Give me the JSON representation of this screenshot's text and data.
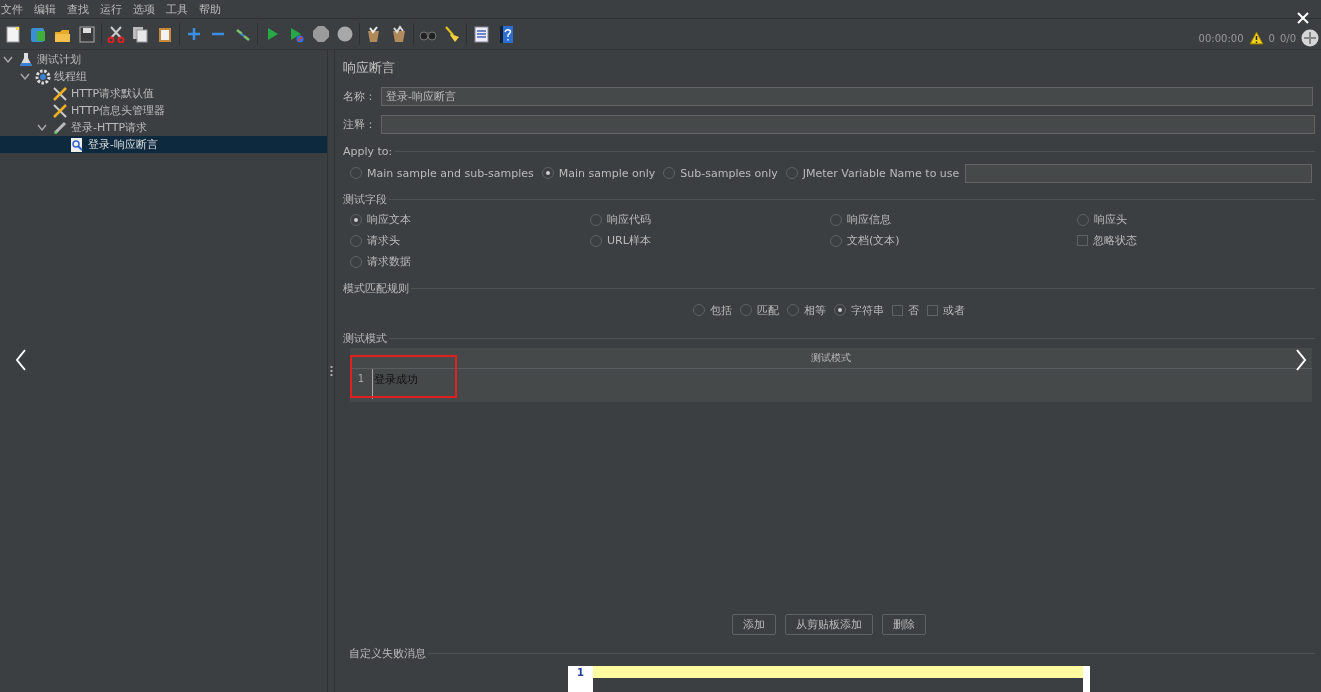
{
  "menu": [
    "文件",
    "编辑",
    "查找",
    "运行",
    "选项",
    "工具",
    "帮助"
  ],
  "status": {
    "elapsed": "00:00:00",
    "warnings": "0",
    "threads": "0/0"
  },
  "tree": [
    {
      "label": "测试计划",
      "kind": "plan",
      "expanded": true,
      "selected": false,
      "children": [
        {
          "label": "线程组",
          "kind": "group",
          "expanded": true,
          "selected": false,
          "children": [
            {
              "label": "HTTP请求默认值",
              "kind": "config",
              "selected": false
            },
            {
              "label": "HTTP信息头管理器",
              "kind": "config",
              "selected": false
            },
            {
              "label": "登录-HTTP请求",
              "kind": "sampler",
              "expanded": true,
              "selected": false,
              "children": [
                {
                  "label": "登录-响应断言",
                  "kind": "assertion",
                  "selected": true
                }
              ]
            }
          ]
        }
      ]
    }
  ],
  "panel": {
    "title": "响应断言",
    "name_label": "名称：",
    "name": "登录-响应断言",
    "comment_label": "注释："
  },
  "apply_to": {
    "legend": "Apply to:",
    "options": [
      {
        "kind": "radio",
        "label": "Main sample and sub-samples",
        "selected": false
      },
      {
        "kind": "radio",
        "label": "Main sample only",
        "selected": true
      },
      {
        "kind": "radio",
        "label": "Sub-samples only",
        "selected": false
      },
      {
        "kind": "radio",
        "label": "JMeter Variable Name to use",
        "selected": false
      }
    ]
  },
  "test_field": {
    "legend": "测试字段",
    "options": [
      {
        "kind": "radio",
        "label": "响应文本",
        "selected": true
      },
      {
        "kind": "radio",
        "label": "响应代码",
        "selected": false
      },
      {
        "kind": "radio",
        "label": "响应信息",
        "selected": false
      },
      {
        "kind": "radio",
        "label": "响应头",
        "selected": false
      },
      {
        "kind": "radio",
        "label": "请求头",
        "selected": false
      },
      {
        "kind": "radio",
        "label": "URL样本",
        "selected": false
      },
      {
        "kind": "radio",
        "label": "文档(文本)",
        "selected": false
      },
      {
        "kind": "checkbox",
        "label": "忽略状态",
        "checked": false
      },
      {
        "kind": "radio",
        "label": "请求数据",
        "selected": false
      }
    ]
  },
  "pattern_rules": {
    "legend": "模式匹配规则",
    "options": [
      {
        "kind": "radio",
        "label": "包括",
        "selected": false
      },
      {
        "kind": "radio",
        "label": "匹配",
        "selected": false
      },
      {
        "kind": "radio",
        "label": "相等",
        "selected": false
      },
      {
        "kind": "radio",
        "label": "字符串",
        "selected": true
      },
      {
        "kind": "checkbox",
        "label": "否",
        "checked": false
      },
      {
        "kind": "checkbox",
        "label": "或者",
        "checked": false
      }
    ]
  },
  "patterns": {
    "legend": "测试模式",
    "column": "测试模式",
    "rows": [
      {
        "line": "1",
        "text": "登录成功",
        "highlighted": true
      }
    ]
  },
  "buttons": [
    "添加",
    "从剪贴板添加",
    "删除"
  ],
  "failure_message": {
    "legend": "自定义失败消息",
    "line": "1"
  }
}
